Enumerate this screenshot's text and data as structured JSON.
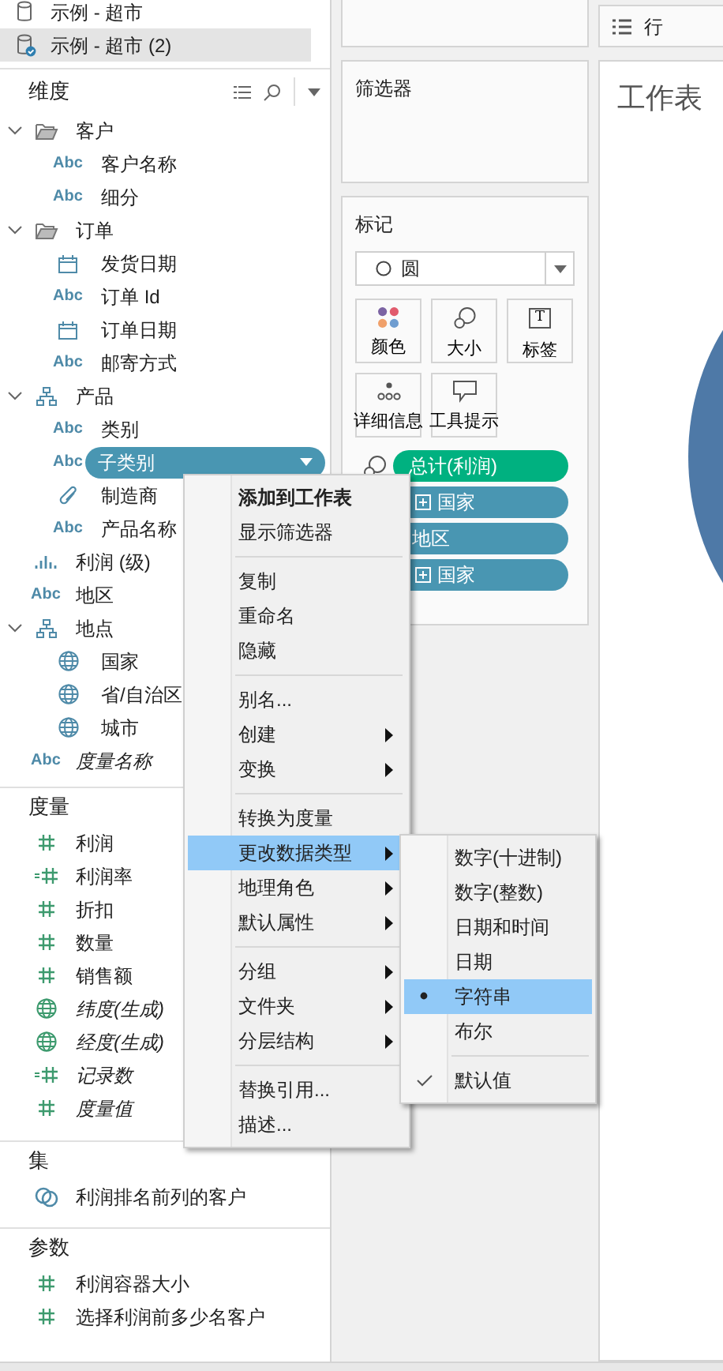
{
  "data_sources": [
    {
      "label": "示例 - 超市",
      "selected": false,
      "connected": false
    },
    {
      "label": "示例 - 超市 (2)",
      "selected": true,
      "connected": true
    }
  ],
  "dimensions": {
    "title": "维度",
    "items": [
      {
        "label": "客户",
        "kind": "folder",
        "expanded": true,
        "selected": false,
        "italic": false,
        "children": [
          {
            "label": "客户名称",
            "kind": "text",
            "icon_text": "Abc",
            "selected": false,
            "italic": false
          },
          {
            "label": "细分",
            "kind": "text",
            "icon_text": "Abc",
            "selected": false,
            "italic": false
          }
        ]
      },
      {
        "label": "订单",
        "kind": "folder",
        "expanded": true,
        "selected": false,
        "italic": false,
        "children": [
          {
            "label": "发货日期",
            "kind": "date",
            "selected": false,
            "italic": false
          },
          {
            "label": "订单 Id",
            "kind": "text",
            "icon_text": "Abc",
            "selected": false,
            "italic": false
          },
          {
            "label": "订单日期",
            "kind": "date",
            "selected": false,
            "italic": false
          },
          {
            "label": "邮寄方式",
            "kind": "text",
            "icon_text": "Abc",
            "selected": false,
            "italic": false
          }
        ]
      },
      {
        "label": "产品",
        "kind": "hierarchy",
        "expanded": true,
        "selected": false,
        "italic": false,
        "children": [
          {
            "label": "类别",
            "kind": "text",
            "icon_text": "Abc",
            "selected": false,
            "italic": false
          },
          {
            "label": "子类别",
            "kind": "text",
            "icon_text": "Abc",
            "selected": true,
            "italic": false
          },
          {
            "label": "制造商",
            "kind": "clip",
            "selected": false,
            "italic": false
          },
          {
            "label": "产品名称",
            "kind": "text",
            "icon_text": "Abc",
            "selected": false,
            "italic": false
          }
        ]
      },
      {
        "label": "利润 (级)",
        "kind": "bins",
        "selected": false,
        "italic": false
      },
      {
        "label": "地区",
        "kind": "text",
        "icon_text": "Abc",
        "selected": false,
        "italic": false
      },
      {
        "label": "地点",
        "kind": "hierarchy",
        "expanded": true,
        "selected": false,
        "italic": false,
        "children": [
          {
            "label": "国家",
            "kind": "geo",
            "selected": false,
            "italic": false
          },
          {
            "label": "省/自治区",
            "kind": "geo",
            "selected": false,
            "italic": false
          },
          {
            "label": "城市",
            "kind": "geo",
            "selected": false,
            "italic": false
          }
        ]
      },
      {
        "label": "度量名称",
        "kind": "text",
        "icon_text": "Abc",
        "selected": false,
        "italic": true
      }
    ]
  },
  "measures": {
    "title": "度量",
    "items": [
      {
        "label": "利润",
        "kind": "number",
        "selected": false,
        "italic": false
      },
      {
        "label": "利润率",
        "kind": "calc",
        "selected": false,
        "italic": false
      },
      {
        "label": "折扣",
        "kind": "number",
        "selected": false,
        "italic": false
      },
      {
        "label": "数量",
        "kind": "number",
        "selected": false,
        "italic": false
      },
      {
        "label": "销售额",
        "kind": "number",
        "selected": false,
        "italic": false
      },
      {
        "label": "纬度(生成)",
        "kind": "geo",
        "selected": false,
        "italic": true
      },
      {
        "label": "经度(生成)",
        "kind": "geo",
        "selected": false,
        "italic": true
      },
      {
        "label": "记录数",
        "kind": "calc",
        "selected": false,
        "italic": true
      },
      {
        "label": "度量值",
        "kind": "number",
        "selected": false,
        "italic": true
      }
    ]
  },
  "sets": {
    "title": "集",
    "items": [
      {
        "label": "利润排名前列的客户",
        "kind": "set",
        "selected": false,
        "italic": false
      }
    ]
  },
  "parameters": {
    "title": "参数",
    "items": [
      {
        "label": "利润容器大小",
        "kind": "number",
        "selected": false,
        "italic": false
      },
      {
        "label": "选择利润前多少名客户",
        "kind": "number",
        "selected": false,
        "italic": false
      }
    ]
  },
  "filters": {
    "title": "筛选器"
  },
  "marks": {
    "title": "标记",
    "mark_type": "圆",
    "buttons": [
      {
        "label": "颜色",
        "kind": "color"
      },
      {
        "label": "大小",
        "kind": "size"
      },
      {
        "label": "标签",
        "kind": "label",
        "icon_text": "T"
      },
      {
        "label": "详细信息",
        "kind": "detail"
      },
      {
        "label": "工具提示",
        "kind": "tooltip"
      }
    ],
    "pills": [
      {
        "label": "总计(利润)",
        "color": "#00b180",
        "kind": "size",
        "expand": false
      },
      {
        "label": "国家",
        "color": "#4996b2",
        "kind": "detail",
        "expand": true
      },
      {
        "label": "地区",
        "color": "#4996b2",
        "kind": "detail",
        "expand": false
      },
      {
        "label": "国家",
        "color": "#4996b2",
        "kind": "detail",
        "expand": true
      }
    ]
  },
  "rows_shelf": {
    "label": "行"
  },
  "view": {
    "title": "工作表"
  },
  "context_menu": {
    "items": [
      {
        "kind": "item",
        "label": "添加到工作表",
        "bold": true,
        "submenu": false,
        "highlighted": false
      },
      {
        "kind": "item",
        "label": "显示筛选器",
        "bold": false,
        "submenu": false,
        "highlighted": false
      },
      {
        "kind": "separator"
      },
      {
        "kind": "item",
        "label": "复制",
        "bold": false,
        "submenu": false,
        "highlighted": false
      },
      {
        "kind": "item",
        "label": "重命名",
        "bold": false,
        "submenu": false,
        "highlighted": false
      },
      {
        "kind": "item",
        "label": "隐藏",
        "bold": false,
        "submenu": false,
        "highlighted": false
      },
      {
        "kind": "separator"
      },
      {
        "kind": "item",
        "label": "别名...",
        "bold": false,
        "submenu": false,
        "highlighted": false
      },
      {
        "kind": "item",
        "label": "创建",
        "bold": false,
        "submenu": true,
        "highlighted": false
      },
      {
        "kind": "item",
        "label": "变换",
        "bold": false,
        "submenu": true,
        "highlighted": false
      },
      {
        "kind": "separator"
      },
      {
        "kind": "item",
        "label": "转换为度量",
        "bold": false,
        "submenu": false,
        "highlighted": false
      },
      {
        "kind": "item",
        "label": "更改数据类型",
        "bold": false,
        "submenu": true,
        "highlighted": true
      },
      {
        "kind": "item",
        "label": "地理角色",
        "bold": false,
        "submenu": true,
        "highlighted": false
      },
      {
        "kind": "item",
        "label": "默认属性",
        "bold": false,
        "submenu": true,
        "highlighted": false
      },
      {
        "kind": "separator"
      },
      {
        "kind": "item",
        "label": "分组",
        "bold": false,
        "submenu": true,
        "highlighted": false
      },
      {
        "kind": "item",
        "label": "文件夹",
        "bold": false,
        "submenu": true,
        "highlighted": false
      },
      {
        "kind": "item",
        "label": "分层结构",
        "bold": false,
        "submenu": true,
        "highlighted": false
      },
      {
        "kind": "separator"
      },
      {
        "kind": "item",
        "label": "替换引用...",
        "bold": false,
        "submenu": false,
        "highlighted": false
      },
      {
        "kind": "item",
        "label": "描述...",
        "bold": false,
        "submenu": false,
        "highlighted": false
      }
    ]
  },
  "data_type_menu": {
    "items": [
      {
        "label": "数字(十进制)",
        "selected": false,
        "highlighted": false
      },
      {
        "label": "数字(整数)",
        "selected": false,
        "highlighted": false
      },
      {
        "label": "日期和时间",
        "selected": false,
        "highlighted": false
      },
      {
        "label": "日期",
        "selected": false,
        "highlighted": false
      },
      {
        "label": "字符串",
        "selected": true,
        "highlighted": true
      },
      {
        "label": "布尔",
        "selected": false,
        "highlighted": false
      }
    ],
    "default_item": {
      "label": "默认值",
      "checked": true
    }
  }
}
